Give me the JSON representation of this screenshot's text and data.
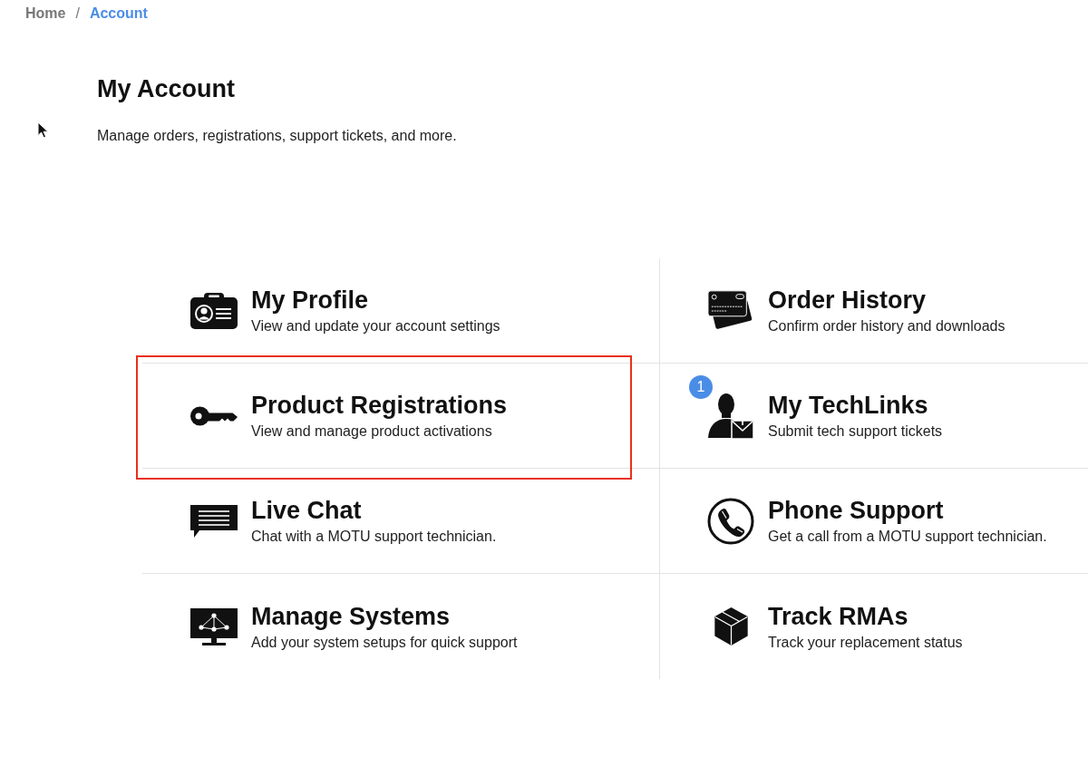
{
  "breadcrumb": {
    "separator": "/",
    "items": [
      {
        "label": "Home",
        "selected": false
      },
      {
        "label": "Account",
        "selected": true
      }
    ]
  },
  "header": {
    "title": "My Account",
    "subtitle": "Manage orders, registrations, support tickets, and more."
  },
  "tiles": [
    {
      "title": "My Profile",
      "description": "View and update your account settings",
      "highlighted": false
    },
    {
      "title": "Order History",
      "description": "Confirm order history and downloads",
      "highlighted": false
    },
    {
      "title": "Product Registrations",
      "description": "View and manage product activations",
      "highlighted": true
    },
    {
      "title": "My TechLinks",
      "description": "Submit tech support tickets",
      "badge": "1",
      "highlighted": false
    },
    {
      "title": "Live Chat",
      "description": "Chat with a MOTU support technician.",
      "highlighted": false
    },
    {
      "title": "Phone Support",
      "description": "Get a call from a MOTU support technician.",
      "highlighted": false
    },
    {
      "title": "Manage Systems",
      "description": "Add your system setups for quick support",
      "highlighted": false
    },
    {
      "title": "Track RMAs",
      "description": "Track your replacement status",
      "highlighted": false
    }
  ]
}
